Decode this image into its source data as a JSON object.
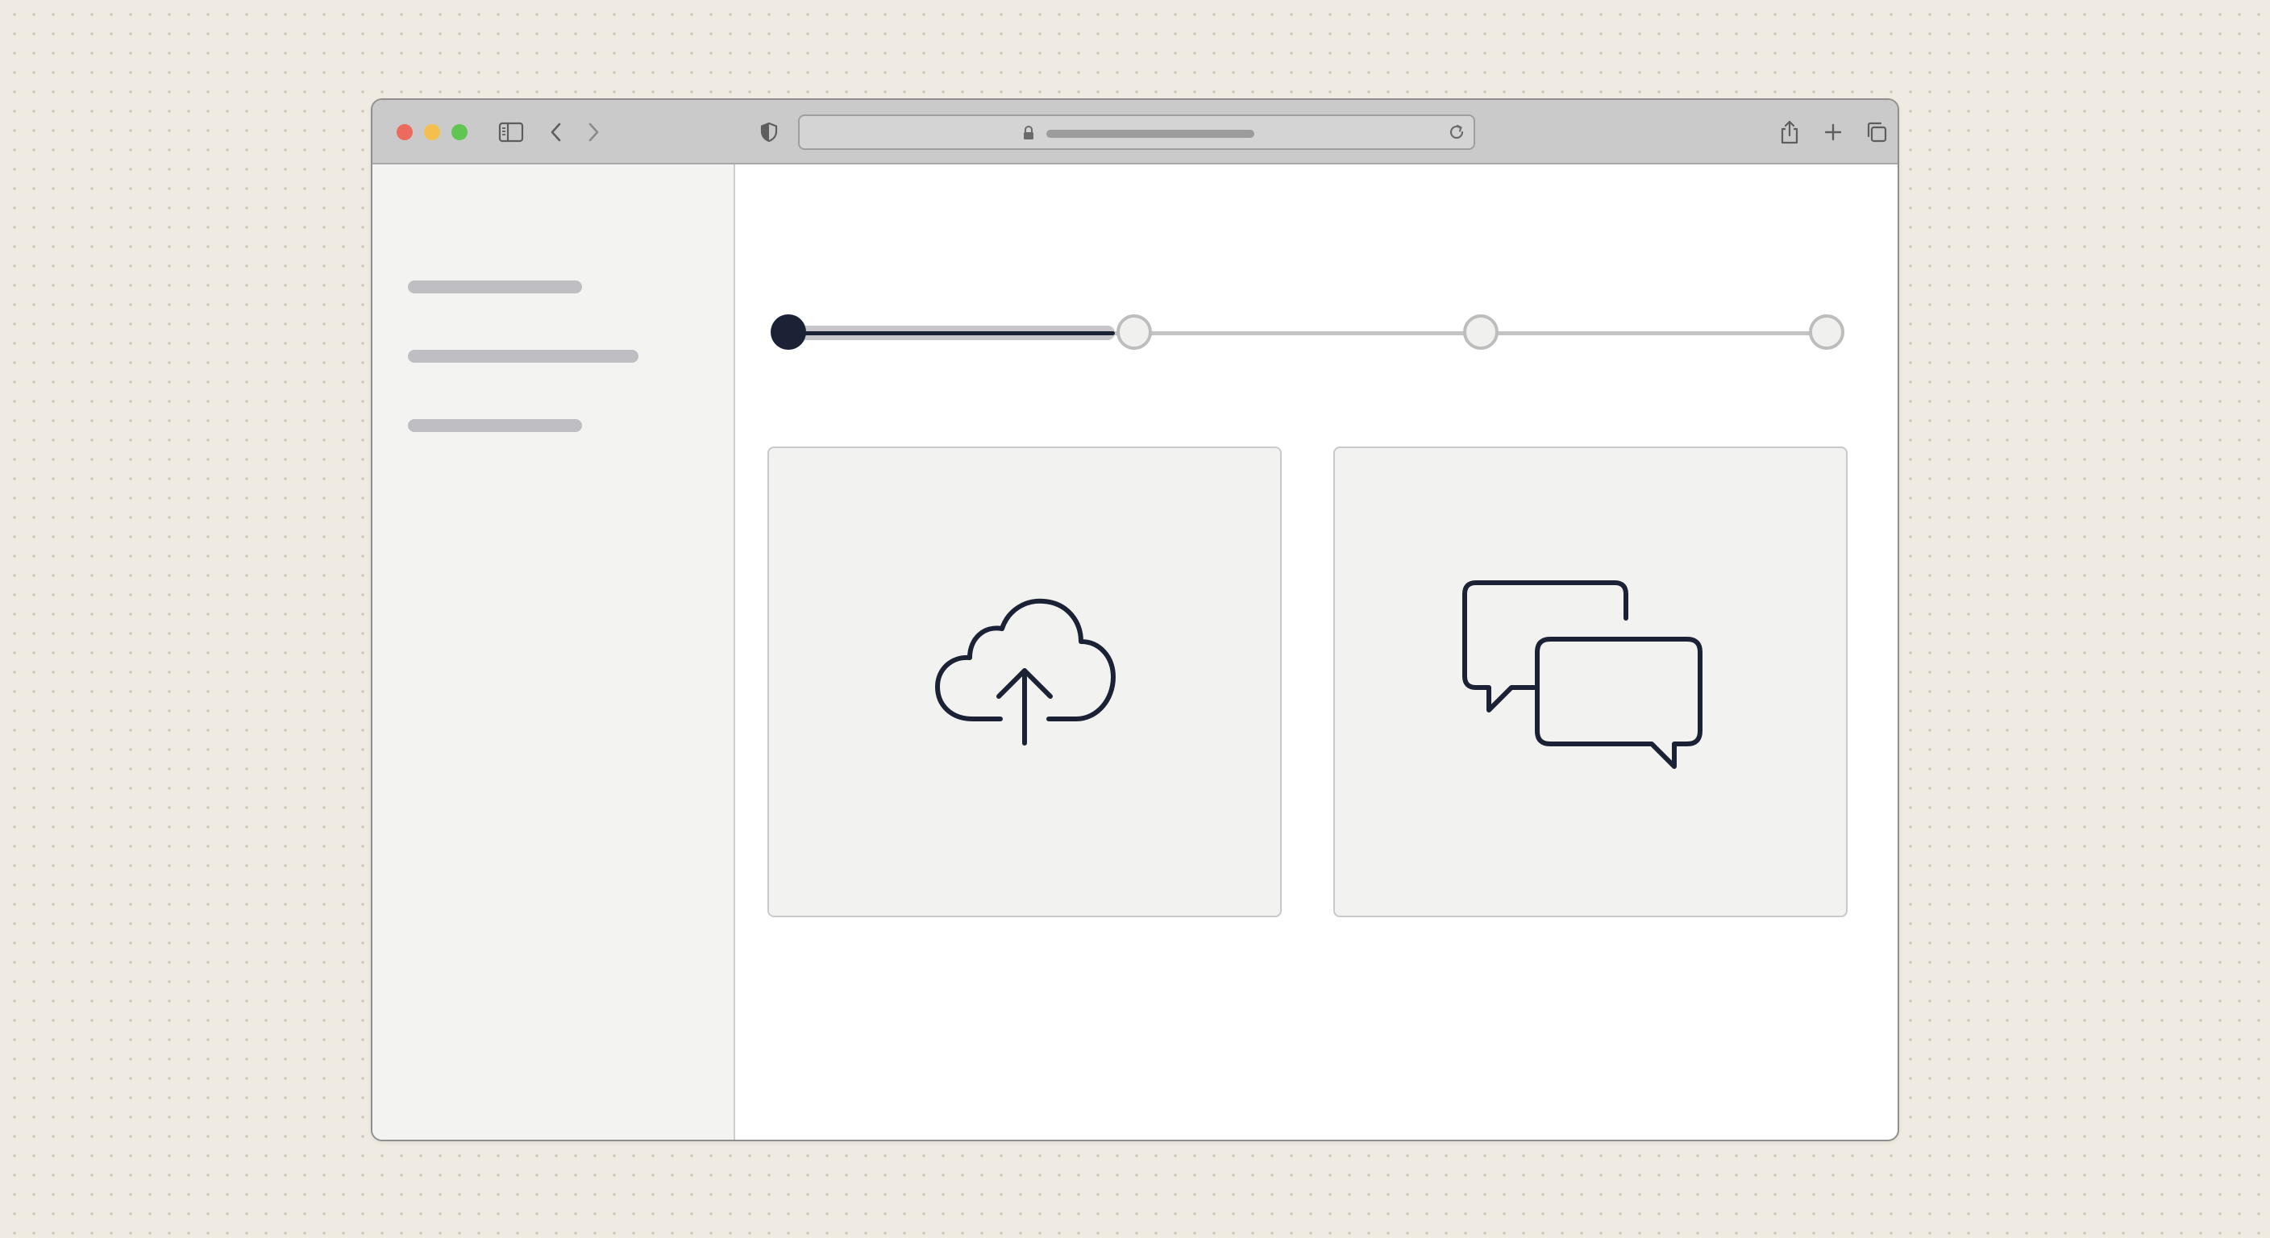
{
  "browser": {
    "traffic_lights": {
      "close_color": "#ec6a5e",
      "minimize_color": "#f4bf4f",
      "zoom_color": "#61c554"
    },
    "toolbar_icons": [
      "sidebar-toggle-icon",
      "chevron-left-icon",
      "chevron-right-icon",
      "shield-icon",
      "share-icon",
      "plus-icon",
      "tabs-overview-icon"
    ],
    "address_bar": {
      "icons": [
        "lock-icon",
        "reload-icon"
      ]
    }
  },
  "stepper": {
    "total_steps": 4,
    "current_step": 1,
    "active_color": "#1c2235",
    "inactive_color": "#bdbdbd"
  },
  "cards": [
    {
      "icon": "cloud-upload-icon"
    },
    {
      "icon": "chat-bubbles-icon"
    }
  ],
  "colors": {
    "accent": "#1c2235",
    "background": "#efebe2",
    "sidebar": "#f3f3f1",
    "card": "#f2f2f0"
  }
}
